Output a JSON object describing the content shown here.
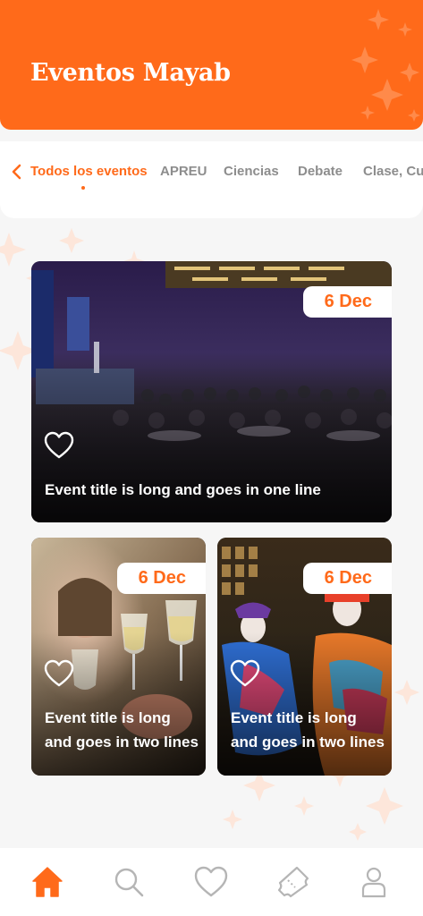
{
  "header": {
    "title": "Eventos Mayab"
  },
  "tabs": [
    {
      "label": "Todos los eventos",
      "active": true
    },
    {
      "label": "APREU",
      "active": false
    },
    {
      "label": "Ciencias",
      "active": false
    },
    {
      "label": "Debate",
      "active": false
    },
    {
      "label": "Clase, Cur",
      "active": false
    }
  ],
  "events": [
    {
      "date": "6 Dec",
      "title": "Event title is long and goes in one line",
      "favorite": false,
      "image": "conference-hall"
    },
    {
      "date": "6 Dec",
      "title_line1": "Event title is long",
      "title_line2": "and goes in two lines",
      "favorite": false,
      "image": "wine-toast"
    },
    {
      "date": "6 Dec",
      "title_line1": "Event title is long",
      "title_line2": "and goes in two lines",
      "favorite": false,
      "image": "day-of-the-dead-dancers"
    }
  ],
  "bottom_nav": [
    {
      "icon": "home-icon",
      "active": true
    },
    {
      "icon": "search-icon",
      "active": false
    },
    {
      "icon": "heart-icon",
      "active": false
    },
    {
      "icon": "ticket-icon",
      "active": false
    },
    {
      "icon": "profile-icon",
      "active": false
    }
  ],
  "colors": {
    "accent": "#ff6a1a",
    "inactive": "#8d8d8d",
    "background": "#f6f6f6"
  }
}
